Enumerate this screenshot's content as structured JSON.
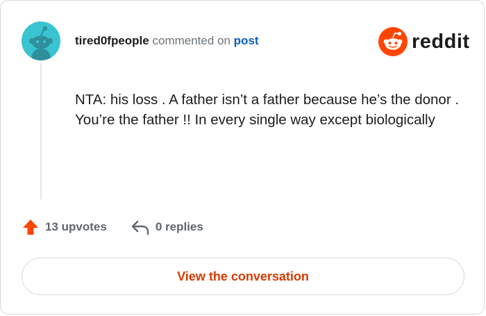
{
  "comment": {
    "username": "tired0fpeople",
    "action_text": "commented on",
    "post_link": "post",
    "body": "NTA: his loss . A father isn’t a father because he’s the donor . You’re the father !! In every single way except biologically"
  },
  "brand": {
    "name": "reddit",
    "accent_color": "#ff4500"
  },
  "stats": {
    "upvotes_label": "13 upvotes",
    "replies_label": "0 replies"
  },
  "cta": {
    "label": "View the conversation"
  },
  "icons": {
    "avatar": "snoo-avatar-icon",
    "logo": "reddit-logo-icon",
    "upvote": "upvote-arrow-icon",
    "reply": "reply-arrow-icon"
  }
}
